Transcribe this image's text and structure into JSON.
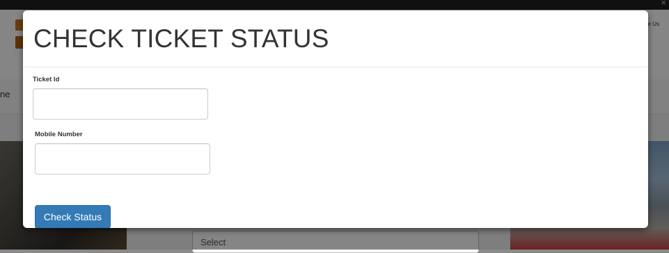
{
  "background": {
    "header_contact": "e Us",
    "nav_item": "ne",
    "select_placeholder": "Select"
  },
  "modal": {
    "title": "CHECK TICKET STATUS",
    "ticket_id_label": "Ticket Id",
    "ticket_id_value": "",
    "mobile_label": "Mobile Number",
    "mobile_value": "",
    "submit_label": "Check Status"
  },
  "colors": {
    "primary_button": "#337ab7",
    "overlay": "rgba(0,0,0,0.48)"
  }
}
